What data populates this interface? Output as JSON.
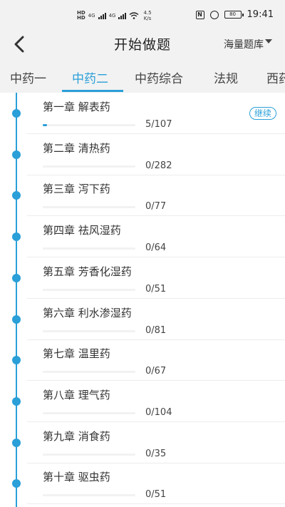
{
  "status_bar": {
    "hd_top": "HD",
    "hd_bottom": "HD",
    "net_1": "4G",
    "net_2": "4G",
    "speed_value": "4.5",
    "speed_unit": "K/s",
    "nfc": "N",
    "battery": "80",
    "time": "19:41"
  },
  "header": {
    "title": "开始做题",
    "bank_label": "海量题库"
  },
  "tabs": [
    {
      "label": "中药一"
    },
    {
      "label": "中药二"
    },
    {
      "label": "中药综合"
    },
    {
      "label": "法规"
    },
    {
      "label": "西药"
    }
  ],
  "active_tab_index": 1,
  "accent_color": "#2a9fd8",
  "chapters": [
    {
      "title": "第一章 解表药",
      "progress": "5/107",
      "done": 5,
      "total": 107,
      "badge": "继续"
    },
    {
      "title": "第二章 清热药",
      "progress": "0/282",
      "done": 0,
      "total": 282
    },
    {
      "title": "第三章 泻下药",
      "progress": "0/77",
      "done": 0,
      "total": 77
    },
    {
      "title": "第四章 祛风湿药",
      "progress": "0/64",
      "done": 0,
      "total": 64
    },
    {
      "title": "第五章 芳香化湿药",
      "progress": "0/51",
      "done": 0,
      "total": 51
    },
    {
      "title": "第六章 利水渗湿药",
      "progress": "0/81",
      "done": 0,
      "total": 81
    },
    {
      "title": "第七章 温里药",
      "progress": "0/67",
      "done": 0,
      "total": 67
    },
    {
      "title": "第八章 理气药",
      "progress": "0/104",
      "done": 0,
      "total": 104
    },
    {
      "title": "第九章 消食药",
      "progress": "0/35",
      "done": 0,
      "total": 35
    },
    {
      "title": "第十章 驱虫药",
      "progress": "0/51",
      "done": 0,
      "total": 51
    }
  ]
}
